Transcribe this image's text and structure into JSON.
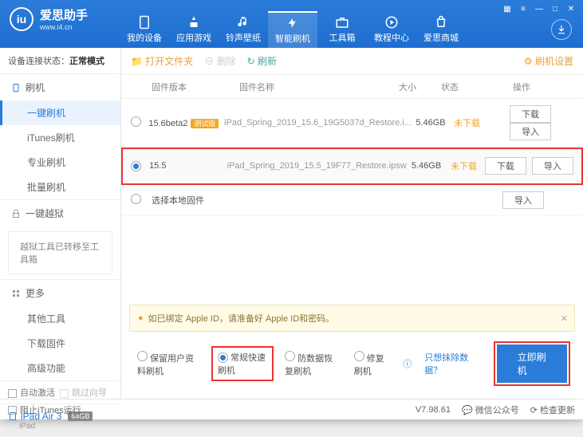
{
  "app": {
    "name": "爱思助手",
    "url": "www.i4.cn"
  },
  "nav": {
    "items": [
      "我的设备",
      "应用游戏",
      "铃声壁纸",
      "智能刷机",
      "工具箱",
      "教程中心",
      "爱思商城"
    ],
    "active_index": 3
  },
  "sidebar": {
    "conn_label": "设备连接状态：",
    "conn_value": "正常模式",
    "flash": {
      "title": "刷机",
      "items": [
        "一键刷机",
        "iTunes刷机",
        "专业刷机",
        "批量刷机"
      ],
      "active_index": 0
    },
    "jailbreak": {
      "title": "一键越狱",
      "note": "越狱工具已转移至工具箱"
    },
    "more": {
      "title": "更多",
      "items": [
        "其他工具",
        "下载固件",
        "高级功能"
      ]
    },
    "auto_activate": "自动激活",
    "skip_guide": "跳过向导",
    "device": {
      "name": "iPad Air 3",
      "cap": "64GB",
      "type": "iPad"
    }
  },
  "toolbar": {
    "open_folder": "打开文件夹",
    "delete": "删除",
    "refresh": "刷新",
    "settings": "刷机设置"
  },
  "table": {
    "headers": {
      "version": "固件版本",
      "name": "固件名称",
      "size": "大小",
      "status": "状态",
      "action": "操作"
    },
    "rows": [
      {
        "selected": false,
        "version": "15.6beta2",
        "tag": "测试版",
        "name": "iPad_Spring_2019_15.6_19G5037d_Restore.i...",
        "size": "5.46GB",
        "status": "未下载"
      },
      {
        "selected": true,
        "version": "15.5",
        "tag": "",
        "name": "iPad_Spring_2019_15.5_19F77_Restore.ipsw",
        "size": "5.46GB",
        "status": "未下载"
      }
    ],
    "local_fw": "选择本地固件",
    "btn_download": "下载",
    "btn_import": "导入"
  },
  "warn": "如已绑定 Apple ID，请准备好 Apple ID和密码。",
  "modes": {
    "items": [
      "保留用户资料刷机",
      "常规快速刷机",
      "防数据恢复刷机",
      "修复刷机"
    ],
    "selected_index": 1,
    "help": "只想抹除数据？",
    "action": "立即刷机"
  },
  "status": {
    "block_itunes": "阻止iTunes运行",
    "version": "V7.98.61",
    "wechat": "微信公众号",
    "update": "检查更新"
  }
}
